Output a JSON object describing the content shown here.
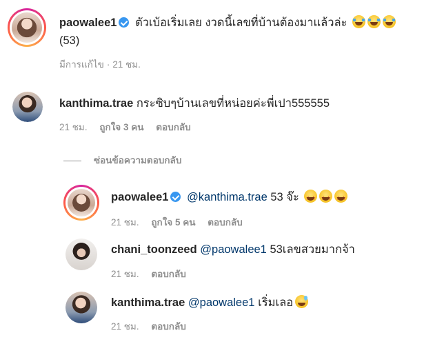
{
  "post": {
    "username": "paowalee1",
    "caption": "ตัวเบ้อเริ่มเลย งวดนี้เลขที่บ้านต้องมาแล้วล่ะ",
    "caption_emojis": [
      "face-with-tears-of-joy",
      "face-with-tears-of-joy",
      "face-with-tears-of-joy"
    ],
    "caption_suffix": "(53)",
    "edited_label": "มีการแก้ไข",
    "time": "21 ชม."
  },
  "comments": [
    {
      "username": "kanthima.trae",
      "text": "กระซิบๆบ้านเลขที่หน่อยค่ะพี่เปา555555",
      "time": "21 ชม.",
      "likes": "ถูกใจ 3 คน",
      "reply_label": "ตอบกลับ"
    }
  ],
  "hide_replies_label": "ซ่อนข้อความตอบกลับ",
  "replies": [
    {
      "username": "paowalee1",
      "verified": true,
      "mention": "@kanthima.trae",
      "text": "53 จ๊ะ",
      "emojis": [
        "star-struck",
        "star-struck",
        "star-struck"
      ],
      "time": "21 ชม.",
      "likes": "ถูกใจ 5 คน",
      "reply_label": "ตอบกลับ"
    },
    {
      "username": "chani_toonzeed",
      "mention": "@paowalee1",
      "text": "53เลขสวยมากจ้า",
      "time": "21 ชม.",
      "reply_label": "ตอบกลับ"
    },
    {
      "username": "kanthima.trae",
      "mention": "@paowalee1",
      "text": "เริ่มเลอ",
      "emojis": [
        "grinning-face-with-sweat"
      ],
      "time": "21 ชม.",
      "reply_label": "ตอบกลับ"
    }
  ],
  "colors": {
    "text": "#262626",
    "meta": "#8e8e8e",
    "mention": "#00376b",
    "verified": "#3897f0"
  }
}
